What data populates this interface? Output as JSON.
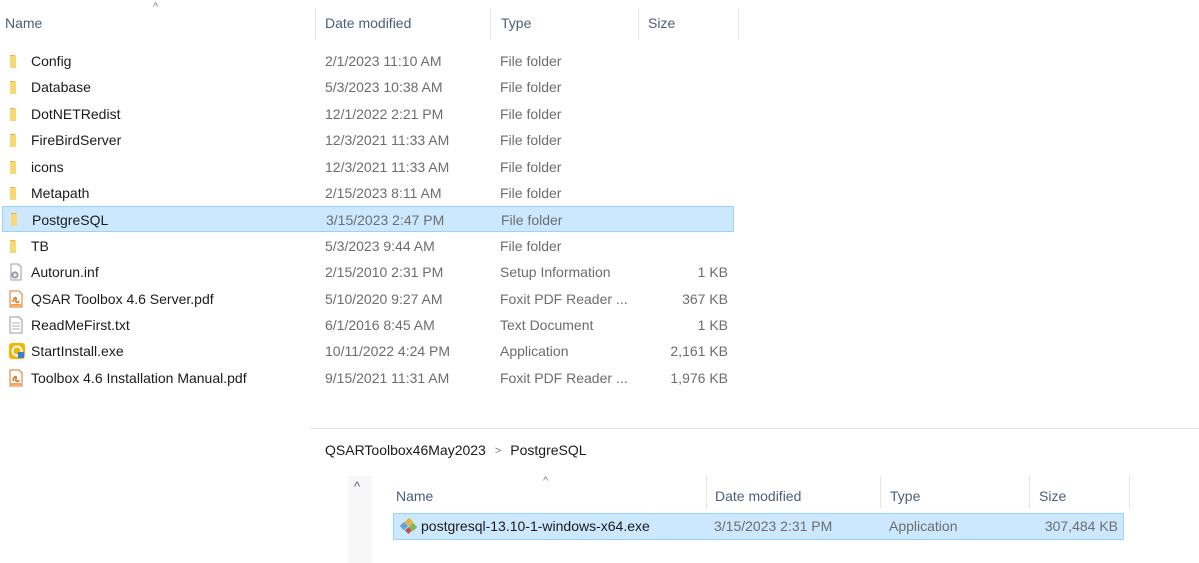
{
  "top_pane": {
    "columns": {
      "name": "Name",
      "date": "Date modified",
      "type": "Type",
      "size": "Size"
    },
    "sort_indicator": "^",
    "files": [
      {
        "icon": "folder-icon",
        "name": "Config",
        "date": "2/1/2023 11:10 AM",
        "type": "File folder",
        "size": ""
      },
      {
        "icon": "folder-icon",
        "name": "Database",
        "date": "5/3/2023 10:38 AM",
        "type": "File folder",
        "size": ""
      },
      {
        "icon": "folder-icon",
        "name": "DotNETRedist",
        "date": "12/1/2022 2:21 PM",
        "type": "File folder",
        "size": ""
      },
      {
        "icon": "folder-icon",
        "name": "FireBirdServer",
        "date": "12/3/2021 11:33 AM",
        "type": "File folder",
        "size": ""
      },
      {
        "icon": "folder-icon",
        "name": "icons",
        "date": "12/3/2021 11:33 AM",
        "type": "File folder",
        "size": ""
      },
      {
        "icon": "folder-icon",
        "name": "Metapath",
        "date": "2/15/2023 8:11 AM",
        "type": "File folder",
        "size": ""
      },
      {
        "icon": "folder-icon",
        "name": "PostgreSQL",
        "date": "3/15/2023 2:47 PM",
        "type": "File folder",
        "size": "",
        "selected": true
      },
      {
        "icon": "folder-icon",
        "name": "TB",
        "date": "5/3/2023 9:44 AM",
        "type": "File folder",
        "size": ""
      },
      {
        "icon": "setup-info-icon",
        "name": "Autorun.inf",
        "date": "2/15/2010 2:31 PM",
        "type": "Setup Information",
        "size": "1 KB"
      },
      {
        "icon": "pdf-icon",
        "name": "QSAR Toolbox 4.6 Server.pdf",
        "date": "5/10/2020 9:27 AM",
        "type": "Foxit PDF Reader ...",
        "size": "367 KB"
      },
      {
        "icon": "text-document-icon",
        "name": "ReadMeFirst.txt",
        "date": "6/1/2016 8:45 AM",
        "type": "Text Document",
        "size": "1 KB"
      },
      {
        "icon": "installer-exe-icon",
        "name": "StartInstall.exe",
        "date": "10/11/2022 4:24 PM",
        "type": "Application",
        "size": "2,161 KB"
      },
      {
        "icon": "pdf-icon",
        "name": "Toolbox 4.6 Installation Manual.pdf",
        "date": "9/15/2021 11:31 AM",
        "type": "Foxit PDF Reader ...",
        "size": "1,976 KB"
      }
    ]
  },
  "bottom_pane": {
    "breadcrumb": [
      "QSARToolbox46May2023",
      "PostgreSQL"
    ],
    "breadcrumb_separator": ">",
    "collapse_glyph": "^",
    "columns": {
      "name": "Name",
      "date": "Date modified",
      "type": "Type",
      "size": "Size"
    },
    "sort_indicator": "^",
    "files": [
      {
        "icon": "postgresql-installer-icon",
        "name": "postgresql-13.10-1-windows-x64.exe",
        "date": "3/15/2023 2:31 PM",
        "type": "Application",
        "size": "307,484 KB",
        "selected": true
      }
    ]
  },
  "colors": {
    "selection_fill": "#cce8ff",
    "selection_border": "#99d1ff",
    "header_text": "#4c607a",
    "secondary_text": "#6d6d6d",
    "folder_yellow": "#f8d775"
  }
}
